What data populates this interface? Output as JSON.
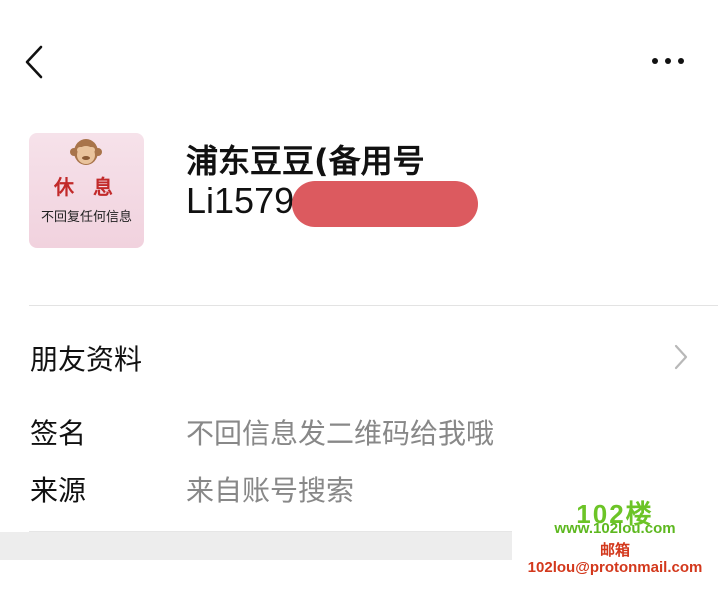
{
  "top_bar": {
    "back_icon": "chevron-left-icon",
    "more_icon": "ellipsis-icon"
  },
  "profile": {
    "avatar": {
      "line1": "休 息",
      "line2": "不回复任何信息"
    },
    "nickname": "浦东豆豆(备用号",
    "wechat_id": "Li1579"
  },
  "friend_info": {
    "label": "朋友资料",
    "chevron_icon": "chevron-right-icon"
  },
  "signature": {
    "label": "签名",
    "value": "不回信息发二维码给我哦"
  },
  "source": {
    "label": "来源",
    "value": "来自账号搜索"
  },
  "watermark": {
    "logo": "102楼",
    "url": "www.102lou.com",
    "mail_label": "邮箱",
    "email": "102lou@protonmail.com"
  },
  "colors": {
    "redaction": "#dc5a5f",
    "secondary_text": "#888888",
    "watermark_green": "#6cc427",
    "watermark_red": "#d3381c"
  }
}
